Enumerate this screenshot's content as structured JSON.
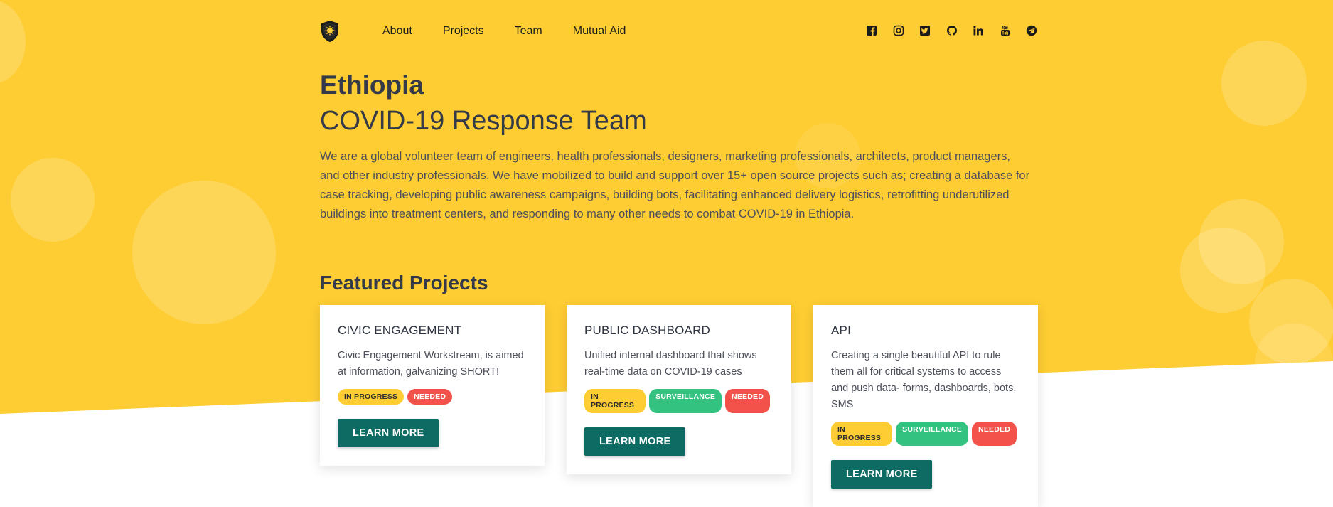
{
  "nav": {
    "links": [
      "About",
      "Projects",
      "Team",
      "Mutual Aid"
    ],
    "socials": [
      "facebook-icon",
      "instagram-icon",
      "twitter-icon",
      "github-icon",
      "linkedin-icon",
      "youtube-icon",
      "telegram-icon"
    ]
  },
  "hero": {
    "country": "Ethiopia",
    "team": "COVID-19 Response Team",
    "intro": "We are a global volunteer team of engineers, health professionals, designers, marketing professionals, architects, product managers, and other industry professionals. We have mobilized to build and support over 15+ open source projects such as; creating a database for case tracking, developing public awareness campaigns, building bots, facilitating enhanced delivery logistics, retrofitting underutilized buildings into treatment centers, and responding to many other needs to combat COVID-19 in Ethiopia."
  },
  "featured": {
    "heading": "Featured Projects",
    "cards": [
      {
        "title": "CIVIC ENGAGEMENT",
        "description": "Civic Engagement Workstream, is aimed at information, galvanizing SHORT!",
        "badges": [
          "IN PROGRESS",
          "NEEDED"
        ],
        "button": "LEARN MORE"
      },
      {
        "title": "PUBLIC DASHBOARD",
        "description": "Unified internal dashboard that shows real-time data on COVID-19 cases",
        "badges": [
          "IN PROGRESS",
          "SURVEILLANCE",
          "NEEDED"
        ],
        "button": "LEARN MORE"
      },
      {
        "title": "API",
        "description": "Creating a single beautiful API to rule them all for critical systems to access and push data- forms, dashboards, bots, SMS",
        "badges": [
          "IN PROGRESS",
          "SURVEILLANCE",
          "NEEDED"
        ],
        "button": "LEARN MORE"
      }
    ]
  },
  "colors": {
    "hero": "#fecd33",
    "button": "#0d6b63",
    "badge_in_progress": "#fecd33",
    "badge_surveillance": "#33c27f",
    "badge_needed": "#f2524a"
  }
}
